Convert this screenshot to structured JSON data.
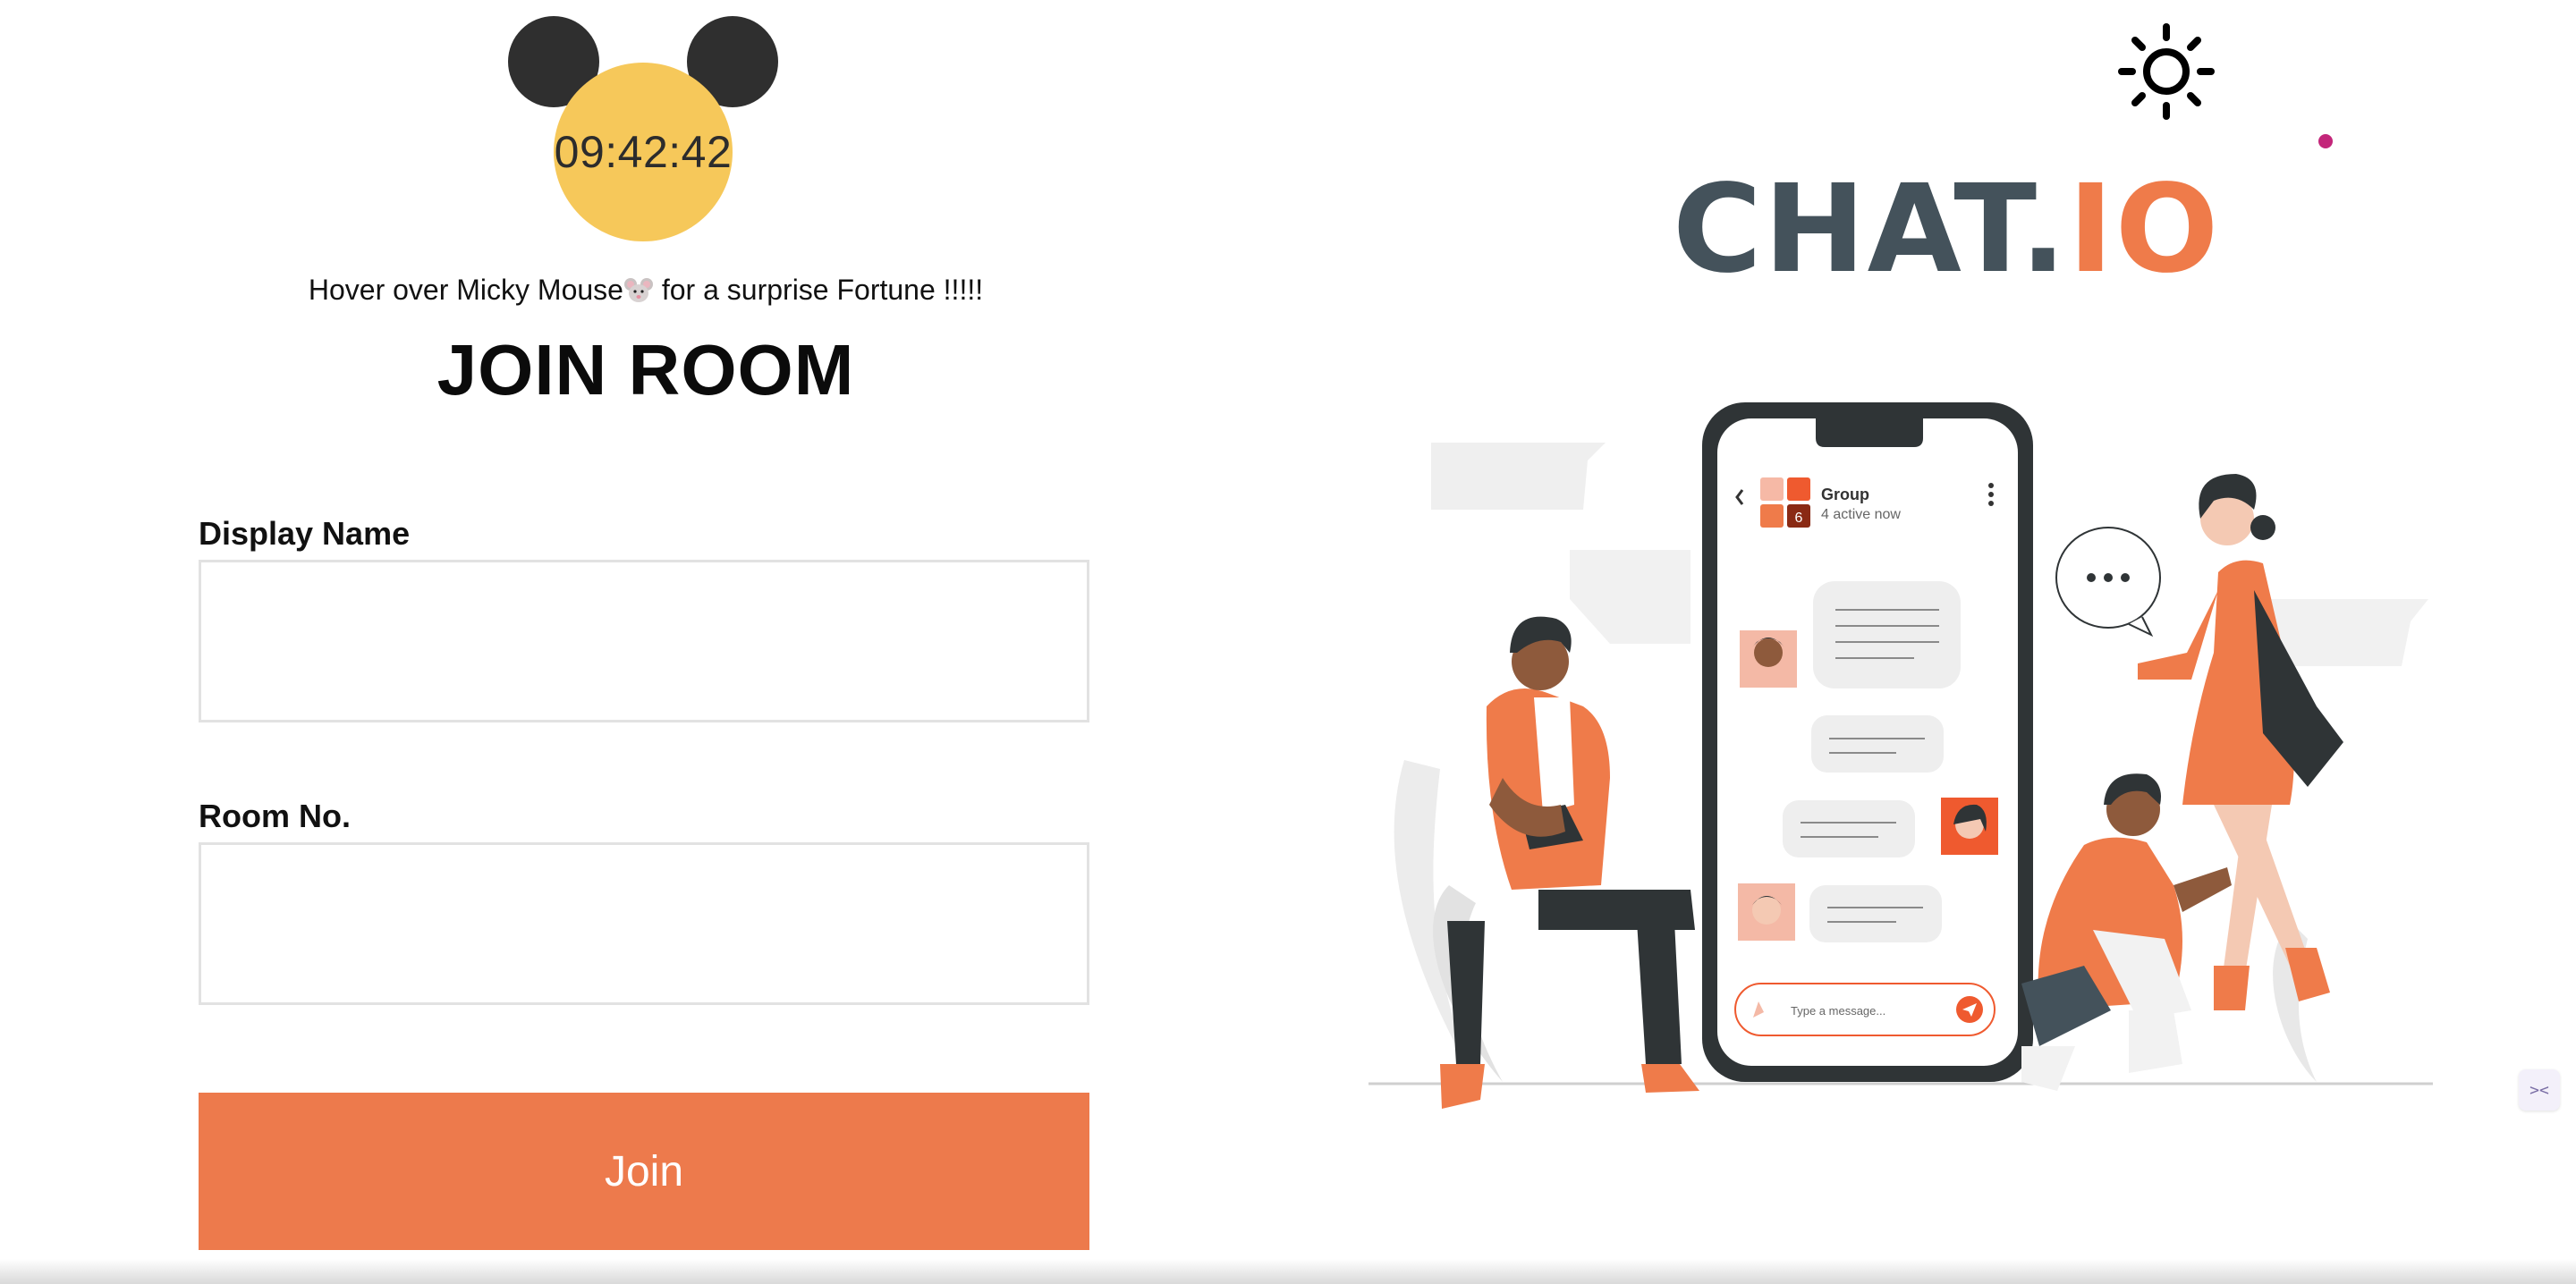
{
  "clock": {
    "time": "09:42:42"
  },
  "hint": {
    "text_before": "Hover over Micky Mouse",
    "text_after": " for a surprise Fortune !!!!!"
  },
  "form": {
    "title": "JOIN ROOM",
    "display_name_label": "Display Name",
    "display_name_value": "",
    "room_no_label": "Room No.",
    "room_no_value": "",
    "join_label": "Join"
  },
  "brand": {
    "logo_dark": "CHAT.",
    "logo_accent": "IO"
  },
  "illustration": {
    "phone": {
      "group_name": "Group",
      "group_status": "4 active now",
      "badge": "6",
      "message_placeholder": "Type a message..."
    }
  },
  "colors": {
    "accent": "#ED7A4C",
    "clock_face": "#F6C85A",
    "logo_dark": "#44525B",
    "dot": "#C3267A"
  },
  "icons": {
    "theme_toggle": "sun-icon",
    "corner_widget": "extension-icon"
  }
}
